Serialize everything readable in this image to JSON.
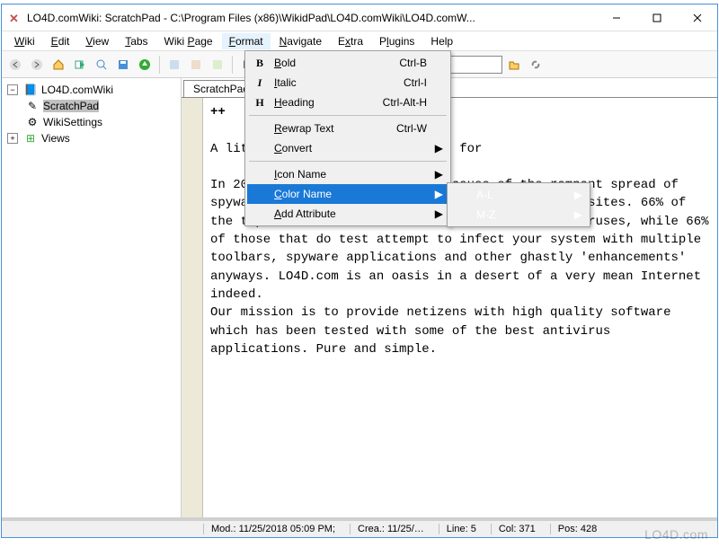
{
  "window": {
    "title": "LO4D.comWiki: ScratchPad - C:\\Program Files (x86)\\WikidPad\\LO4D.comWiki\\LO4D.comW..."
  },
  "menubar": {
    "wiki": "Wiki",
    "edit": "Edit",
    "view": "View",
    "tabs": "Tabs",
    "wikipage": "Wiki Page",
    "format": "Format",
    "navigate": "Navigate",
    "extra": "Extra",
    "plugins": "Plugins",
    "help": "Help"
  },
  "format_menu": {
    "bold": {
      "label": "Bold",
      "shortcut": "Ctrl-B",
      "icon": "B"
    },
    "italic": {
      "label": "Italic",
      "shortcut": "Ctrl-I",
      "icon": "I"
    },
    "heading": {
      "label": "Heading",
      "shortcut": "Ctrl-Alt-H",
      "icon": "H"
    },
    "rewrap": {
      "label": "Rewrap Text",
      "shortcut": "Ctrl-W"
    },
    "convert": {
      "label": "Convert"
    },
    "icon_name": {
      "label": "Icon Name"
    },
    "color_name": {
      "label": "Color Name"
    },
    "add_attribute": {
      "label": "Add Attribute"
    }
  },
  "color_submenu": {
    "al": "A-L",
    "mz": "M-Z"
  },
  "sidebar": {
    "root": "LO4D.comWiki",
    "scratchpad": "ScratchPad",
    "wikisettings": "WikiSettings",
    "views": "Views"
  },
  "tab": {
    "label": "ScratchPad"
  },
  "editor": {
    "heading_marker": "++",
    "paragraphs": [
      "A little bit about what we stand for",
      "In 2008, LO4D.com was created because of the rampant spread of spyware-infested software on the largest download sites. 66% of the top 25 download directories do not test for viruses, while 66% of those that do test attempt to infect your system with multiple toolbars, spyware applications and other ghastly 'enhancements' anyways. LO4D.com is an oasis in a desert of a very mean Internet indeed.",
      "Our mission is to provide netizens with high quality software which has been tested with some of the best antivirus applications. Pure and simple."
    ]
  },
  "status": {
    "mod": "Mod.: 11/25/2018 05:09 PM;",
    "crea": "Crea.: 11/25/…",
    "line": "Line: 5",
    "col": "Col: 371",
    "pos": "Pos: 428"
  },
  "watermark": "LO4D.com"
}
